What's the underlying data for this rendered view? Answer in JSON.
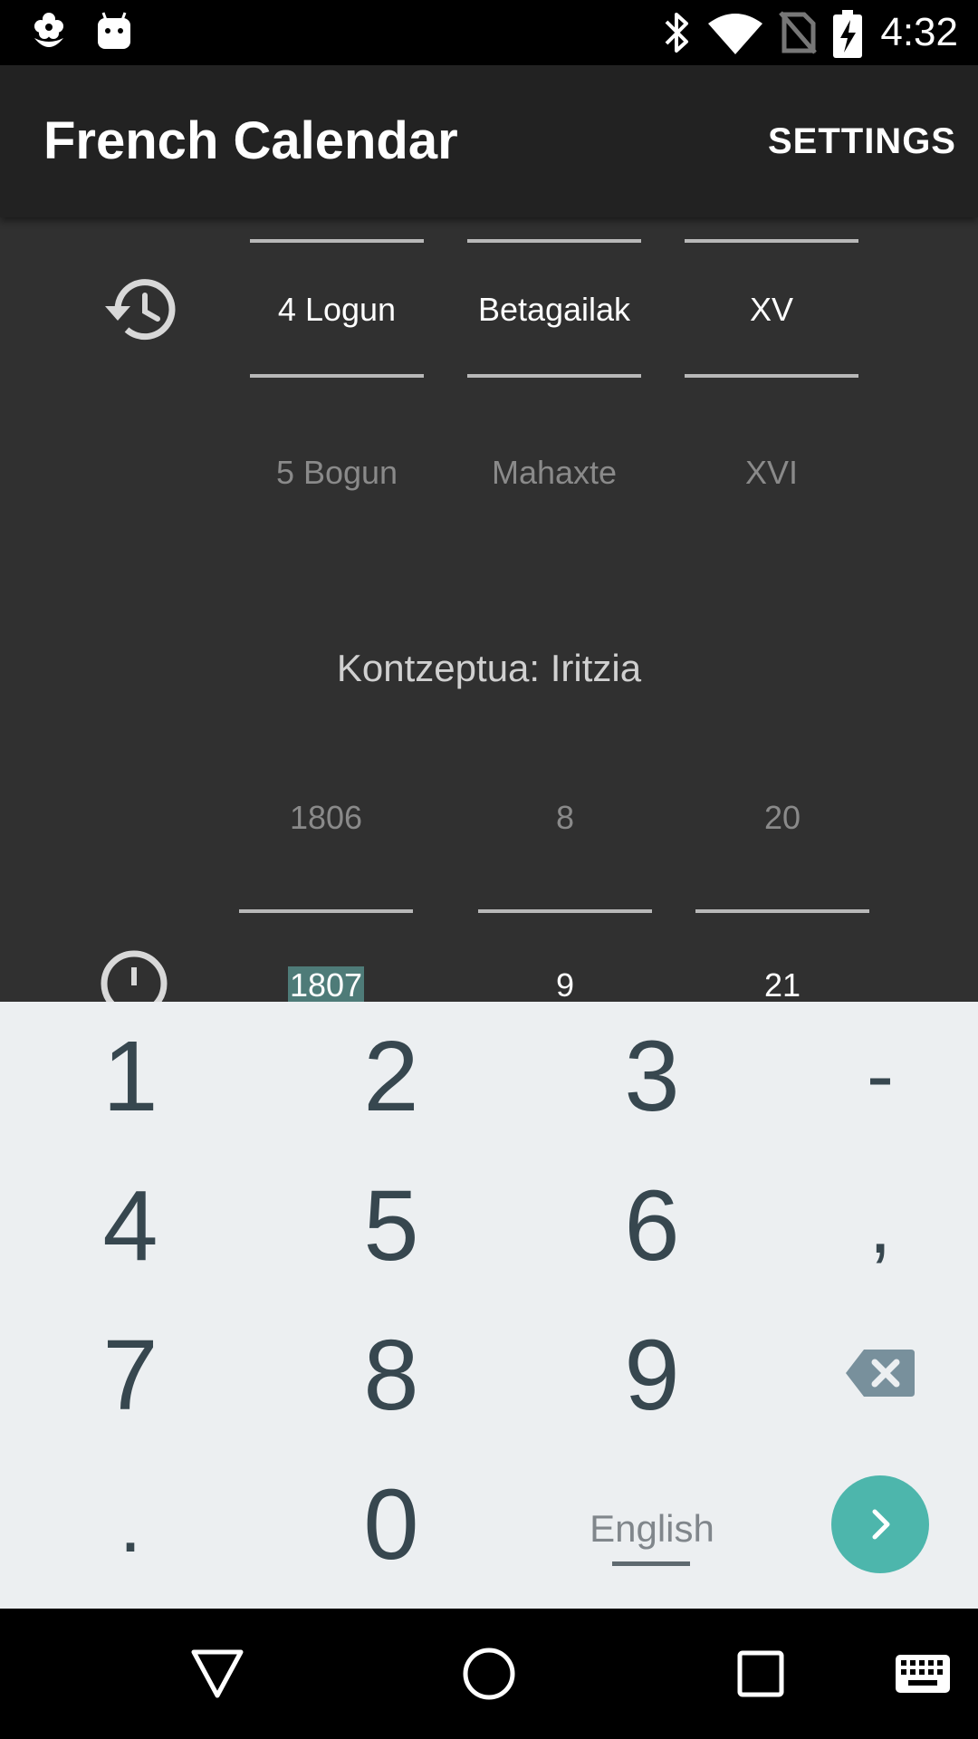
{
  "status_bar": {
    "time": "4:32",
    "icons": [
      "flower-notification-icon",
      "android-notification-icon",
      "bluetooth-icon",
      "wifi-icon",
      "no-sim-icon",
      "battery-charging-icon"
    ]
  },
  "app_bar": {
    "title": "French Calendar",
    "settings_label": "SETTINGS"
  },
  "french_picker": {
    "icon": "history-icon",
    "columns": [
      {
        "selected": "4 Logun",
        "next": "5 Bogun"
      },
      {
        "selected": "Betagailak",
        "next": "Mahaxte"
      },
      {
        "selected": "XV",
        "next": "XVI"
      }
    ]
  },
  "concept_text": "Kontzeptua: Iritzia",
  "gregorian_picker": {
    "icon": "clock-icon",
    "columns": [
      {
        "previous": "1806",
        "selected": "1807"
      },
      {
        "previous": "8",
        "selected": "9"
      },
      {
        "previous": "20",
        "selected": "21"
      }
    ]
  },
  "keyboard": {
    "keys": [
      "1",
      "2",
      "3",
      "-",
      "4",
      "5",
      "6",
      ",",
      "7",
      "8",
      "9",
      ".",
      "0"
    ],
    "backspace_icon": "backspace-icon",
    "language_label": "English",
    "go_icon": "chevron-right-icon",
    "accent_color": "#4db6ac"
  },
  "nav_bar": {
    "icons": [
      "back-icon",
      "home-icon",
      "recents-icon",
      "keyboard-icon"
    ]
  }
}
